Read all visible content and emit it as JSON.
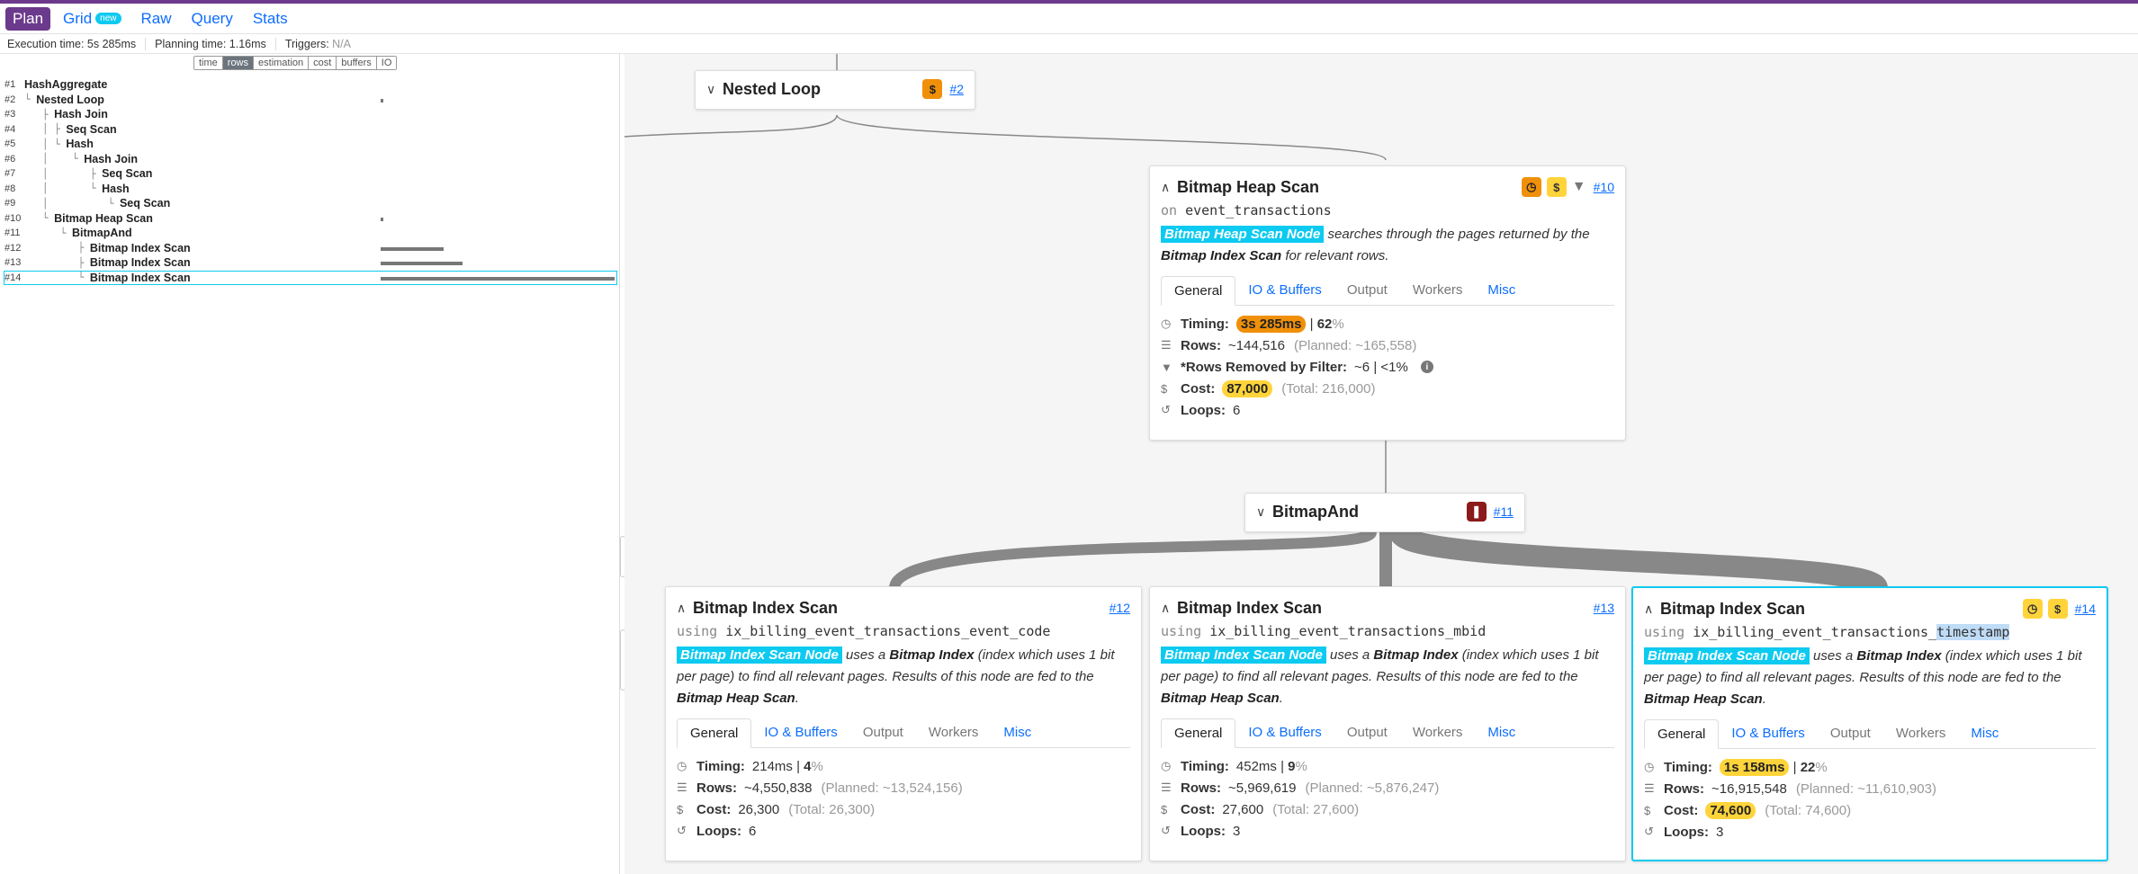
{
  "nav": {
    "plan": "Plan",
    "grid": "Grid",
    "grid_badge": "new",
    "raw": "Raw",
    "query": "Query",
    "stats": "Stats"
  },
  "status": {
    "execution_time": "Execution time: 5s 285ms",
    "planning_time": "Planning time:  1.16ms",
    "triggers_label": "Triggers: ",
    "triggers_value": "N/A"
  },
  "metric_toggles": [
    "time",
    "rows",
    "estimation",
    "cost",
    "buffers",
    "IO"
  ],
  "metric_active": "rows",
  "plan_rows": [
    {
      "id": "#1",
      "tree": "",
      "name": "HashAggregate",
      "bar": 0
    },
    {
      "id": "#2",
      "tree": "└ ",
      "name": "Nested Loop",
      "bar": 0.01
    },
    {
      "id": "#3",
      "tree": "   ├ ",
      "name": "Hash Join",
      "bar": 0
    },
    {
      "id": "#4",
      "tree": "   │ ├ ",
      "name": "Seq Scan",
      "bar": 0
    },
    {
      "id": "#5",
      "tree": "   │ └ ",
      "name": "Hash",
      "bar": 0
    },
    {
      "id": "#6",
      "tree": "   │    └ ",
      "name": "Hash Join",
      "bar": 0
    },
    {
      "id": "#7",
      "tree": "   │       ├ ",
      "name": "Seq Scan",
      "bar": 0
    },
    {
      "id": "#8",
      "tree": "   │       └ ",
      "name": "Hash",
      "bar": 0
    },
    {
      "id": "#9",
      "tree": "   │          └ ",
      "name": "Seq Scan",
      "bar": 0
    },
    {
      "id": "#10",
      "tree": "   └ ",
      "name": "Bitmap Heap Scan",
      "bar": 0.01
    },
    {
      "id": "#11",
      "tree": "      └ ",
      "name": "BitmapAnd",
      "bar": 0
    },
    {
      "id": "#12",
      "tree": "         ├ ",
      "name": "Bitmap Index Scan",
      "bar": 0.27
    },
    {
      "id": "#13",
      "tree": "         ├ ",
      "name": "Bitmap Index Scan",
      "bar": 0.35
    },
    {
      "id": "#14",
      "tree": "         └ ",
      "name": "Bitmap Index Scan",
      "bar": 1.0
    }
  ],
  "nodes": {
    "nested_loop": {
      "title": "Nested Loop",
      "link": "#2",
      "cost_icon": "$"
    },
    "bhs": {
      "title": "Bitmap Heap Scan",
      "link": "#10",
      "on_kw": "on",
      "relation": "event_transactions",
      "desc_tag": "Bitmap Heap Scan Node",
      "desc_1": " searches through the pages returned by the ",
      "desc_b": "Bitmap Index Scan",
      "desc_2": " for relevant rows.",
      "tabs": [
        "General",
        "IO & Buffers",
        "Output",
        "Workers",
        "Misc"
      ],
      "timing_label": "Timing:",
      "timing": "3s 285ms",
      "timing_pct": "62",
      "pct_sign": "%",
      "rows_label": "Rows:",
      "rows": "~144,516",
      "rows_planned": "(Planned: ~165,558)",
      "filter_label": "*Rows Removed by Filter:",
      "filter_value": "~6 |  <1%",
      "cost_label": "Cost:",
      "cost": "87,000",
      "cost_total": "(Total: 216,000)",
      "loops_label": "Loops:",
      "loops": "6"
    },
    "bitmapand": {
      "title": "BitmapAnd",
      "link": "#11"
    },
    "bis12": {
      "title": "Bitmap Index Scan",
      "link": "#12",
      "using_kw": "using",
      "index": "ix_billing_event_transactions_event_code",
      "timing": "214ms",
      "timing_pct": "4",
      "rows": "~4,550,838",
      "rows_planned": "(Planned: ~13,524,156)",
      "cost": "26,300",
      "cost_total": "(Total: 26,300)",
      "loops": "6"
    },
    "bis13": {
      "title": "Bitmap Index Scan",
      "link": "#13",
      "using_kw": "using",
      "index": "ix_billing_event_transactions_mbid",
      "timing": "452ms",
      "timing_pct": "9",
      "rows": "~5,969,619",
      "rows_planned": "(Planned: ~5,876,247)",
      "cost": "27,600",
      "cost_total": "(Total: 27,600)",
      "loops": "3"
    },
    "bis14": {
      "title": "Bitmap Index Scan",
      "link": "#14",
      "using_kw": "using",
      "index_prefix": "ix_billing_event_transactions_",
      "index_hl": "timestamp",
      "timing": "1s 158ms",
      "timing_pct": "22",
      "rows": "~16,915,548",
      "rows_planned": "(Planned: ~11,610,903)",
      "cost": "74,600",
      "cost_total": "(Total: 74,600)",
      "loops": "3"
    },
    "bis_desc": {
      "tag": "Bitmap Index Scan Node",
      "t1": " uses a ",
      "b1": "Bitmap Index",
      "t2": " (index which uses 1 bit per page) to find all relevant pages. Results of this node are fed to the ",
      "b2": "Bitmap Heap Scan",
      "t3": "."
    },
    "labels": {
      "timing": "Timing:",
      "rows": "Rows:",
      "cost": "Cost:",
      "loops": "Loops:",
      "pct_sign": "%",
      "sep": "|"
    }
  },
  "icons": {
    "clock": "clock-icon",
    "dollar": "dollar-icon",
    "filter": "filter-icon",
    "rows": "rows-icon",
    "loops": "loops-icon",
    "info": "info-icon",
    "chevron": "chevron-icon",
    "thumbs": "thumbs-down-icon"
  },
  "colors": {
    "brand": "#6c3a8c",
    "accent": "#0dcaf0",
    "link": "#0d6efd",
    "warn": "#f0900a",
    "cost": "#ffd43b",
    "danger": "#8b1a1a"
  }
}
